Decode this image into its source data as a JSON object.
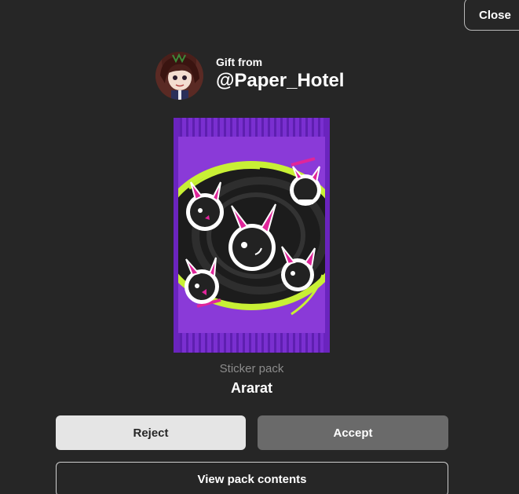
{
  "dialog": {
    "close_label": "Close"
  },
  "sender": {
    "gift_from_label": "Gift from",
    "username": "@Paper_Hotel",
    "avatar_icon": "user-avatar-icon"
  },
  "pack": {
    "type_label": "Sticker pack",
    "name": "Ararat",
    "art_icon": "sticker-pack-art",
    "colors": {
      "wrapper": "#7a2fd0",
      "ring": "#c8f035",
      "accent": "#e0259a",
      "interior": "#1a1a1a"
    }
  },
  "actions": {
    "reject_label": "Reject",
    "accept_label": "Accept",
    "view_contents_label": "View pack contents"
  }
}
